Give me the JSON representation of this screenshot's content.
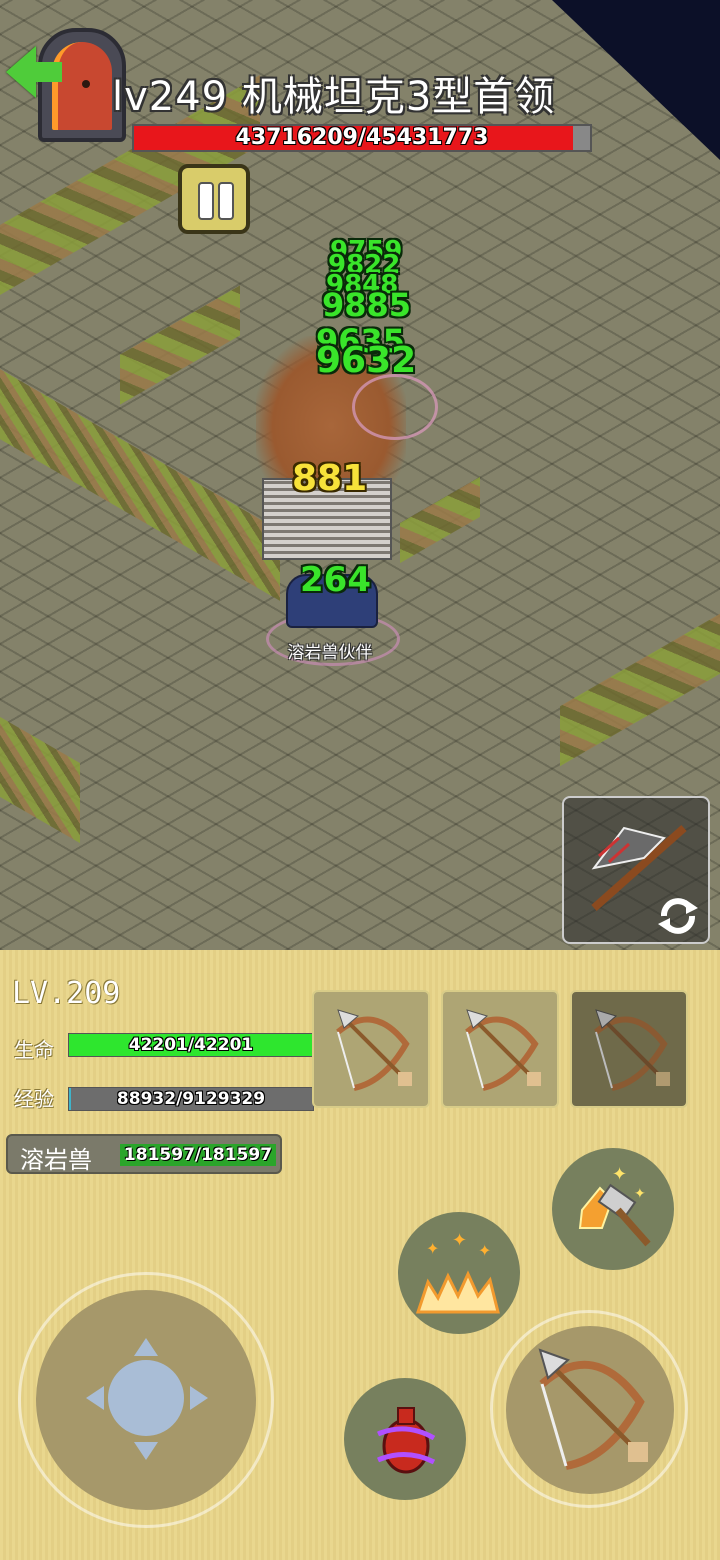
{
  "boss": {
    "title": "lv249 机械坦克3型首领",
    "hp_text": "43716209/45431773",
    "hp_fraction": 0.962
  },
  "damage_numbers": {
    "stack_top": [
      "9759",
      "9822",
      "9848",
      "9885"
    ],
    "stack_mid": [
      "9635",
      "9632"
    ],
    "yellow": "881",
    "partner_hit": "264"
  },
  "partner": {
    "label": "溶岩兽伙伴"
  },
  "player": {
    "level": "LV.209",
    "hp_label": "生命",
    "hp_text": "42201/42201",
    "hp_fraction": 1.0,
    "exp_label": "经验",
    "exp_text": "88932/9129329",
    "exp_fraction": 0.01
  },
  "pet": {
    "name": "溶岩兽",
    "hp_text": "181597/181597"
  },
  "weapon_slots": [
    "bow-icon",
    "bow-icon",
    "bow-icon"
  ],
  "skills": [
    "hammer-icon",
    "fire-burst-icon",
    "potion-icon",
    "bow-icon"
  ],
  "colors": {
    "boss_hp": "#e8161b",
    "player_hp": "#2ee62e",
    "damage_green": "#39e52a",
    "damage_yellow": "#f7e23a",
    "hud_bg": "#e9d78e"
  }
}
